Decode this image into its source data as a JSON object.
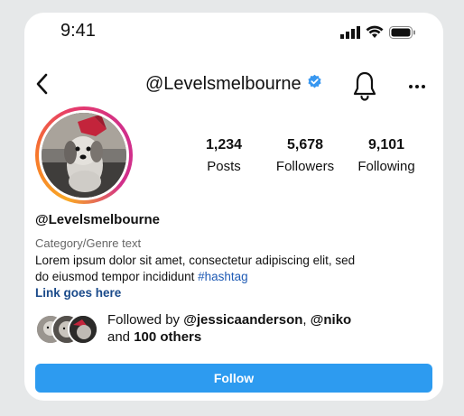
{
  "status_bar": {
    "time": "9:41"
  },
  "header": {
    "username": "@Levelsmelbourne"
  },
  "stats": [
    {
      "value": "1,234",
      "label": "Posts"
    },
    {
      "value": "5,678",
      "label": "Followers"
    },
    {
      "value": "9,101",
      "label": "Following"
    }
  ],
  "profile": {
    "name": "@Levelsmelbourne",
    "category": "Category/Genre text",
    "bio_line1": "Lorem ipsum dolor sit amet, consectetur adipiscing elit, sed",
    "bio_line2_text": "do eiusmod tempor incididunt ",
    "bio_hashtag": "#hashtag",
    "link": "Link goes here"
  },
  "followed_by": {
    "prefix": "Followed by ",
    "user1": "@jessicaanderson",
    "sep": ", ",
    "user2": "@niko",
    "and": "and ",
    "others": "100 others"
  },
  "actions": {
    "follow_label": "Follow"
  },
  "colors": {
    "follow_button": "#2d9bf0",
    "verified": "#3897f0",
    "link": "#1a4a8a",
    "hashtag": "#1f5bb5"
  }
}
